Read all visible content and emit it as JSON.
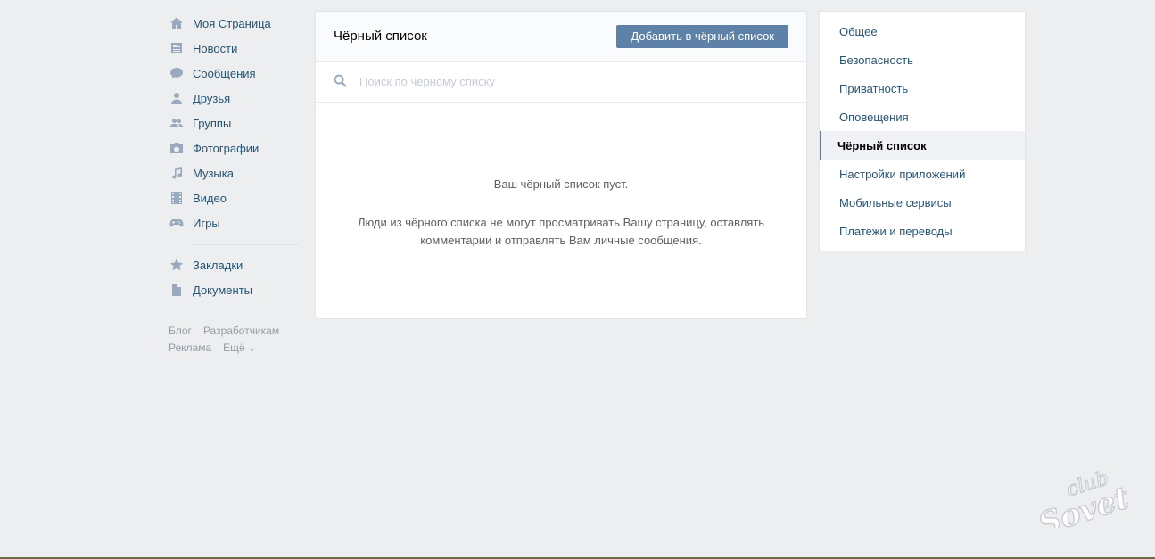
{
  "sidebar": {
    "items": [
      {
        "label": "Моя Страница",
        "icon": "home-icon"
      },
      {
        "label": "Новости",
        "icon": "news-icon"
      },
      {
        "label": "Сообщения",
        "icon": "chat-icon"
      },
      {
        "label": "Друзья",
        "icon": "person-icon"
      },
      {
        "label": "Группы",
        "icon": "group-icon"
      },
      {
        "label": "Фотографии",
        "icon": "camera-icon"
      },
      {
        "label": "Музыка",
        "icon": "music-note-icon"
      },
      {
        "label": "Видео",
        "icon": "film-icon"
      },
      {
        "label": "Игры",
        "icon": "gamepad-icon"
      }
    ],
    "secondary_items": [
      {
        "label": "Закладки",
        "icon": "star-icon"
      },
      {
        "label": "Документы",
        "icon": "document-icon"
      }
    ],
    "footer": {
      "blog": "Блог",
      "developers": "Разработчикам",
      "ads": "Реклама",
      "more": "Ещё"
    }
  },
  "main": {
    "title": "Чёрный список",
    "add_button": "Добавить в чёрный список",
    "search_placeholder": "Поиск по чёрному списку",
    "empty_title": "Ваш чёрный список пуст.",
    "empty_description": "Люди из чёрного списка не могут просматривать Вашу страницу, оставлять комментарии и отправлять Вам личные сообщения."
  },
  "settings_menu": {
    "items": [
      {
        "label": "Общее",
        "active": false
      },
      {
        "label": "Безопасность",
        "active": false
      },
      {
        "label": "Приватность",
        "active": false
      },
      {
        "label": "Оповещения",
        "active": false
      },
      {
        "label": "Чёрный список",
        "active": true
      },
      {
        "label": "Настройки приложений",
        "active": false
      },
      {
        "label": "Мобильные сервисы",
        "active": false
      },
      {
        "label": "Платежи и переводы",
        "active": false
      }
    ]
  },
  "watermark": {
    "text_top": "club",
    "text_bottom": "Sovet"
  },
  "colors": {
    "background": "#edeef0",
    "link": "#285473",
    "accent_button": "#5e81a8",
    "icon": "#99aabe"
  }
}
